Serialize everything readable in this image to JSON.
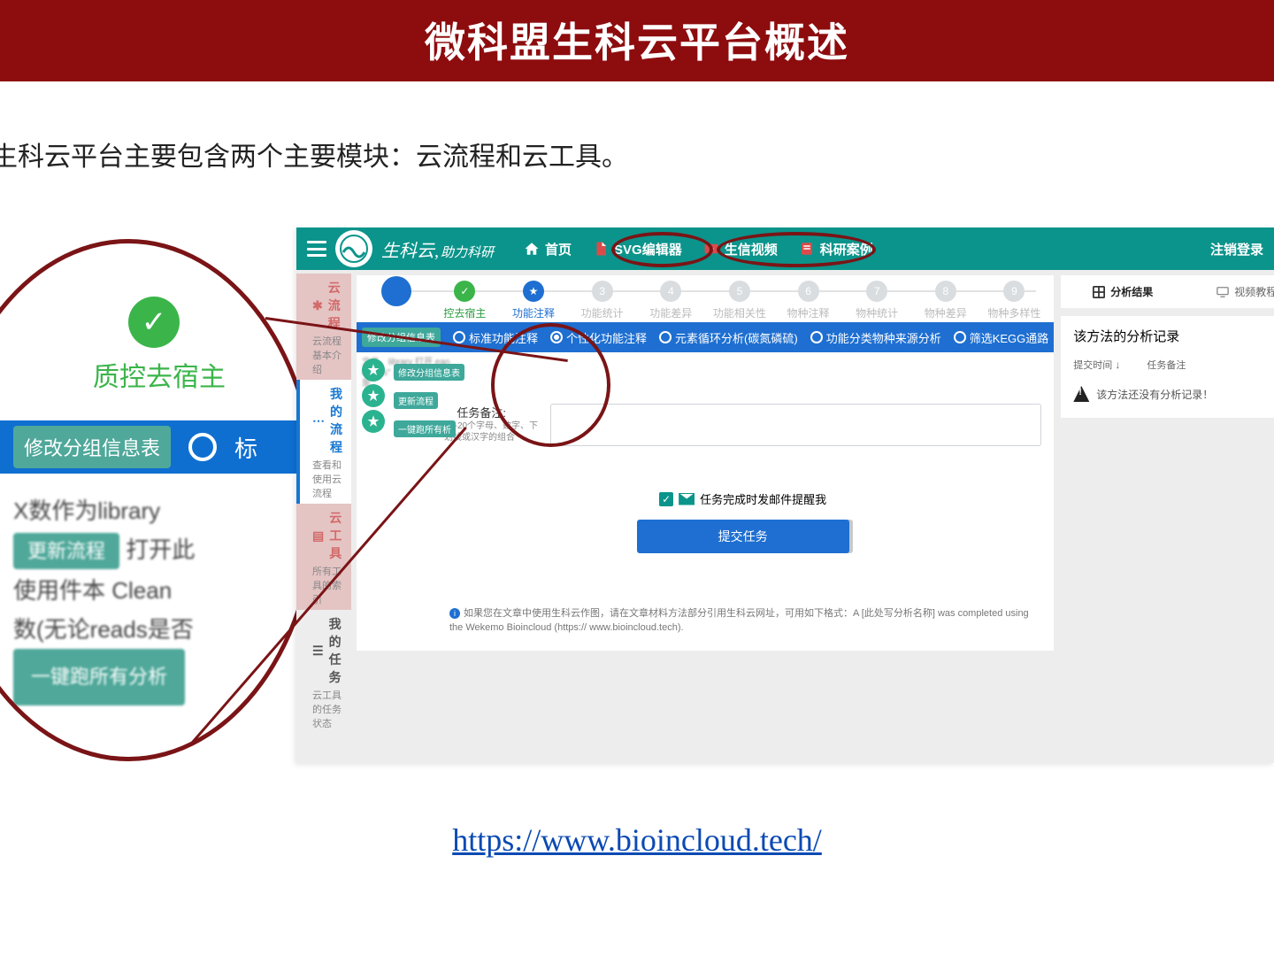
{
  "slide": {
    "title": "微科盟生科云平台概述",
    "intro": "生科云平台主要包含两个主要模块：云流程和云工具。",
    "url_label": "https://www.bioincloud.tech/"
  },
  "zoom": {
    "step_label": "质控去宿主",
    "btn_modify": "修改分组信息表",
    "radio_partial": "标",
    "blur1": "X数作为library",
    "blur2": "打开此",
    "btn_update": "更新流程",
    "blur3": "使用件本  Clean",
    "blur4": "数(无论reads是否",
    "btn_runall": "一键跑所有分析"
  },
  "app": {
    "brand_main": "生科云,",
    "brand_sub": "助力科研",
    "nav": {
      "home": "首页",
      "svg": "SVG编辑器",
      "video": "生信视频",
      "cases": "科研案例"
    },
    "login": "注销登录",
    "sidebar": {
      "flow": {
        "title": "云流程",
        "sub": "云流程基本介绍"
      },
      "myflow": {
        "title": "我的流程",
        "sub": "查看和使用云流程"
      },
      "tools": {
        "title": "云工具",
        "sub": "所有工具的索引"
      },
      "tasks": {
        "title": "我的任务",
        "sub": "云工具的任务状态"
      }
    },
    "steps": [
      {
        "label": "",
        "state": "big"
      },
      {
        "label": "控去宿主",
        "state": "done",
        "icon": "check"
      },
      {
        "label": "功能注释",
        "num": "",
        "state": "active",
        "icon": "star"
      },
      {
        "label": "功能统计",
        "num": "3",
        "state": "pending"
      },
      {
        "label": "功能差异",
        "num": "4",
        "state": "pending"
      },
      {
        "label": "功能相关性",
        "num": "5",
        "state": "pending"
      },
      {
        "label": "物种注释",
        "num": "6",
        "state": "pending"
      },
      {
        "label": "物种统计",
        "num": "7",
        "state": "pending"
      },
      {
        "label": "物种差异",
        "num": "8",
        "state": "pending"
      },
      {
        "label": "物种多样性",
        "num": "9",
        "state": "pending"
      }
    ],
    "options": {
      "pill": "修改分组信息表",
      "opts": [
        {
          "label": "标准功能注释",
          "sel": false
        },
        {
          "label": "个性化功能注释",
          "sel": true
        },
        {
          "label": "元素循环分析(碳氮磷硫)",
          "sel": false
        },
        {
          "label": "功能分类物种来源分析",
          "sel": false
        },
        {
          "label": "筛选KEGG通路",
          "sel": false
        }
      ]
    },
    "stars": {
      "pill1": "修改分组信息表",
      "pill2": "更新流程",
      "pill3": "一键跑所有析",
      "blur": "文件、library\n              打开\n               ean\nReads\" 总数（无论reads是"
    },
    "task": {
      "label": "任务备注:",
      "hint": "0-20个字母、数字、下划线或汉字的组合",
      "placeholder": ""
    },
    "reminder": "任务完成时发邮件提醒我",
    "submit": "提交任务",
    "cite": "如果您在文章中使用生科云作图，请在文章材料方法部分引用生科云网址，可用如下格式：A [此处写分析名称] was completed using the Wekemo Bioincloud (https:// www.bioincloud.tech).",
    "tabs": {
      "result": "分析结果",
      "video": "视频教程"
    },
    "records": {
      "title": "该方法的分析记录",
      "col1": "提交时间",
      "col2": "任务备注",
      "empty": "该方法还没有分析记录！"
    }
  }
}
